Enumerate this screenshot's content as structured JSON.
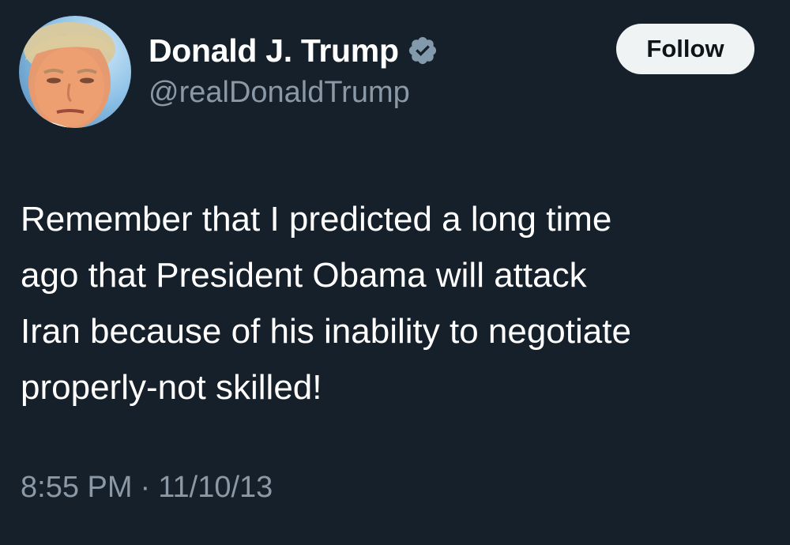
{
  "colors": {
    "background": "#15202b",
    "text_primary": "#ffffff",
    "text_secondary": "#8b98a5",
    "verified_badge": "#829aab",
    "follow_button_bg": "#eff3f4",
    "follow_button_text": "#0f1419"
  },
  "author": {
    "display_name": "Donald J. Trump",
    "handle": "@realDonaldTrump",
    "verified_icon": "verified-badge-icon",
    "avatar_icon": "profile-photo"
  },
  "actions": {
    "follow_label": "Follow"
  },
  "tweet": {
    "text": "Remember that I predicted a long time\nago that President Obama will attack\nIran because of his inability to negotiate\nproperly-not skilled!"
  },
  "meta": {
    "time": "8:55 PM",
    "separator": "·",
    "date": "11/10/13"
  }
}
